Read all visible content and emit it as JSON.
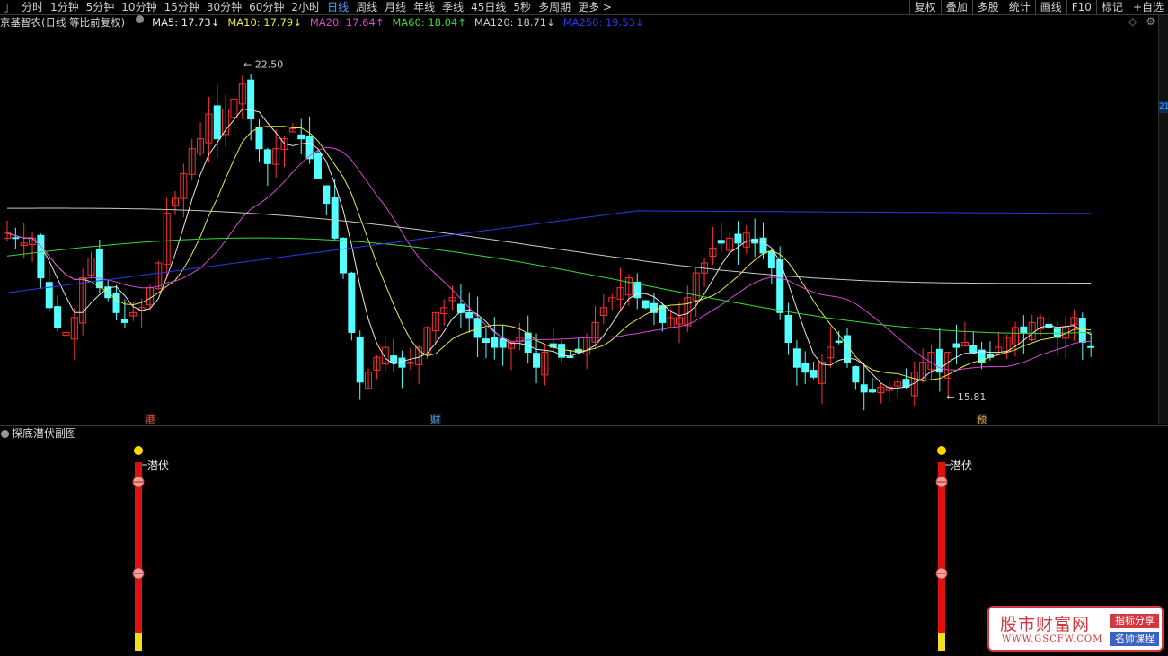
{
  "toolbar": {
    "periods": [
      "分时",
      "1分钟",
      "5分钟",
      "10分钟",
      "15分钟",
      "30分钟",
      "60分钟",
      "2小时",
      "日线",
      "周线",
      "月线",
      "年线",
      "季线",
      "45日线",
      "5秒",
      "多周期",
      "更多 >"
    ],
    "active": "日线",
    "right": [
      "复权",
      "叠加",
      "多股",
      "统计",
      "画线",
      "F10",
      "标记",
      "+自选"
    ]
  },
  "legend": {
    "title": "京基智农(日线 等比前复权)",
    "ma": [
      {
        "label": "MA5: 17.73",
        "arrow": "↓",
        "color": "#e8e8e8"
      },
      {
        "label": "MA10: 17.79",
        "arrow": "↓",
        "color": "#e8e84a"
      },
      {
        "label": "MA20: 17.64",
        "arrow": "↑",
        "color": "#d44ad4"
      },
      {
        "label": "MA60: 18.04",
        "arrow": "↑",
        "color": "#3ad83a"
      },
      {
        "label": "MA120: 18.71",
        "arrow": "↓",
        "color": "#c8c8c8"
      },
      {
        "label": "MA250: 19.53",
        "arrow": "↓",
        "color": "#2a3ae8"
      }
    ]
  },
  "price_tag": "21",
  "annotations": {
    "high": "22.50",
    "low": "15.81"
  },
  "markers": [
    {
      "text": "港",
      "color": "#e8453a"
    },
    {
      "text": "财",
      "color": "#4aa3ff"
    },
    {
      "text": "预",
      "color": "#e8a34a"
    }
  ],
  "sub_panel": {
    "title": "探底潜伏副图",
    "signal_text": "潜伏"
  },
  "watermark": {
    "title": "股市财富网",
    "url": "WWW.GSCFW.COM",
    "tag1": "指标分享",
    "tag2": "名师课程"
  },
  "colors": {
    "up": "#ff3030",
    "down": "#54ffff",
    "ma5": "#e8e8e8",
    "ma10": "#e8e84a",
    "ma20": "#d44ad4",
    "ma60": "#3ad83a",
    "ma120": "#c8c8c8",
    "ma250": "#2a3ae8"
  },
  "chart_data": {
    "type": "candlestick",
    "stock": "京基智农",
    "ylim": [
      15.5,
      23.0
    ],
    "close": [
      19.1,
      19.0,
      18.9,
      19.0,
      18.2,
      17.6,
      17.2,
      17.1,
      17.4,
      18.2,
      18.6,
      18.0,
      17.8,
      17.5,
      17.3,
      17.5,
      17.6,
      18.0,
      18.5,
      19.5,
      19.8,
      20.3,
      20.8,
      21.0,
      21.5,
      21.0,
      21.6,
      21.8,
      22.1,
      21.4,
      20.8,
      20.5,
      20.8,
      21.0,
      21.2,
      21.0,
      20.6,
      20.2,
      19.7,
      19.0,
      18.3,
      17.1,
      16.1,
      16.3,
      16.6,
      16.8,
      16.5,
      16.4,
      16.5,
      16.8,
      17.2,
      17.5,
      17.6,
      17.8,
      17.5,
      17.4,
      17.0,
      16.9,
      16.8,
      16.8,
      16.9,
      17.0,
      16.7,
      16.4,
      16.7,
      16.8,
      16.6,
      16.6,
      16.7,
      17.0,
      17.3,
      17.6,
      17.8,
      18.0,
      18.2,
      17.8,
      17.6,
      17.5,
      17.3,
      17.4,
      17.4,
      17.8,
      18.3,
      18.5,
      18.8,
      18.9,
      19.0,
      18.9,
      19.1,
      18.9,
      18.7,
      18.4,
      17.5,
      16.9,
      16.4,
      16.3,
      16.2,
      16.5,
      16.8,
      16.9,
      16.5,
      16.1,
      15.9,
      15.9,
      16.0,
      16.0,
      16.1,
      16.0,
      16.3,
      16.5,
      16.7,
      16.3,
      16.7,
      16.8,
      16.9,
      16.7,
      16.5,
      16.6,
      16.8,
      17.0,
      17.2,
      17.1,
      17.3,
      17.4,
      17.2,
      17.0,
      17.2,
      17.4,
      16.9,
      16.8
    ],
    "annotations": [
      {
        "label": "22.50",
        "type": "high"
      },
      {
        "label": "15.81",
        "type": "low"
      }
    ]
  }
}
